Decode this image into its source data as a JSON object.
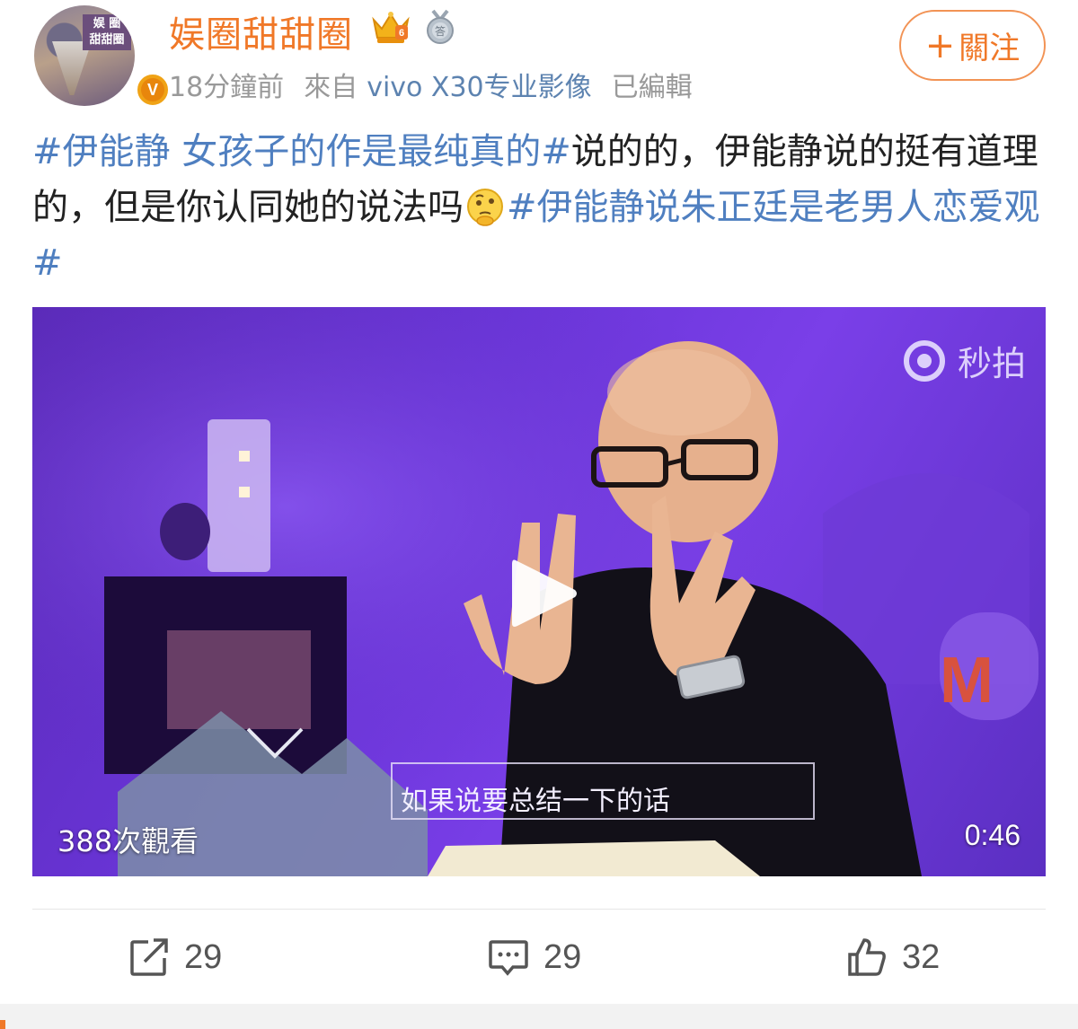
{
  "header": {
    "username": "娱圈甜甜圈",
    "avatar_text": "娱圈甜甜圈",
    "verify_badge": "V",
    "time": "18分鐘前",
    "source_prefix": "來自",
    "source_device": "vivo X30专业影像",
    "edited": "已編輯",
    "follow_label": "關注",
    "icons": [
      "crown-vip-icon",
      "medal-icon"
    ]
  },
  "content": {
    "topic1": "#伊能静 女孩子的作是最纯真的#",
    "text1": "说的的，伊能静说的挺有道理的，但是你认同她的说法吗",
    "emoji": "thinking-face-emoji",
    "topic2": "#伊能静说朱正廷是老男人恋爱观#"
  },
  "video": {
    "watermark": "秒拍",
    "subtitle": "如果说要总结一下的话",
    "views": "388次觀看",
    "duration": "0:46"
  },
  "actions": {
    "repost_count": "29",
    "comment_count": "29",
    "like_count": "32"
  },
  "colors": {
    "username": "#f07828",
    "topic": "#4f7fc0",
    "meta": "#999999",
    "video_bg": "#6a35d8"
  }
}
